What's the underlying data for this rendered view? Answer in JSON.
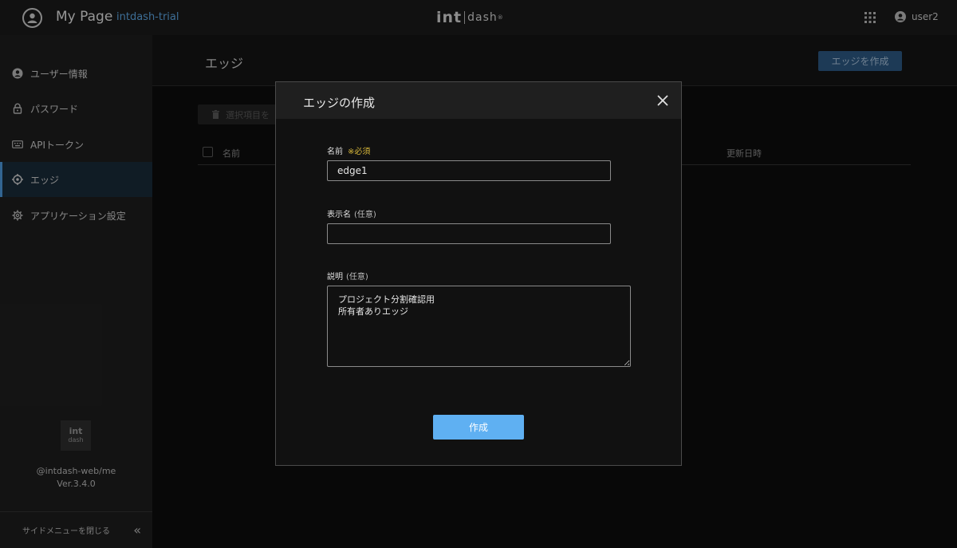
{
  "header": {
    "app_title": "My Page",
    "project_name": "intdash-trial",
    "brand_int": "int",
    "brand_dash": "dash",
    "brand_mark": "®",
    "user_name": "user2"
  },
  "sidebar": {
    "items": [
      {
        "label": "ユーザー情報",
        "icon": "user-circle-icon"
      },
      {
        "label": "パスワード",
        "icon": "lock-icon"
      },
      {
        "label": "APIトークン",
        "icon": "keyboard-icon"
      },
      {
        "label": "エッジ",
        "icon": "crosshair-icon",
        "active": true
      },
      {
        "label": "アプリケーション設定",
        "icon": "gear-icon"
      }
    ],
    "logo_line1": "int",
    "logo_line2": "dash",
    "package_name": "@intdash-web/me",
    "version": "Ver.3.4.0",
    "collapse_label": "サイドメニューを閉じる",
    "collapse_glyph": "«"
  },
  "main": {
    "page_title": "エッジ",
    "create_button": "エッジを作成",
    "delete_button": "選択項目を",
    "columns": {
      "name": "名前",
      "updated": "更新日時"
    }
  },
  "modal": {
    "title": "エッジの作成",
    "name_label": "名前",
    "name_required": "※必須",
    "name_value": "edge1",
    "display_name_label": "表示名",
    "display_name_optional": "(任意)",
    "display_name_value": "",
    "description_label": "説明",
    "description_optional": "(任意)",
    "description_value": "プロジェクト分割確認用\n所有者ありエッジ",
    "submit_label": "作成"
  },
  "colors": {
    "accent": "#5fb0f2",
    "project_link": "#5fa9e6",
    "required": "#d8b83a",
    "background": "#0d0d0d"
  }
}
